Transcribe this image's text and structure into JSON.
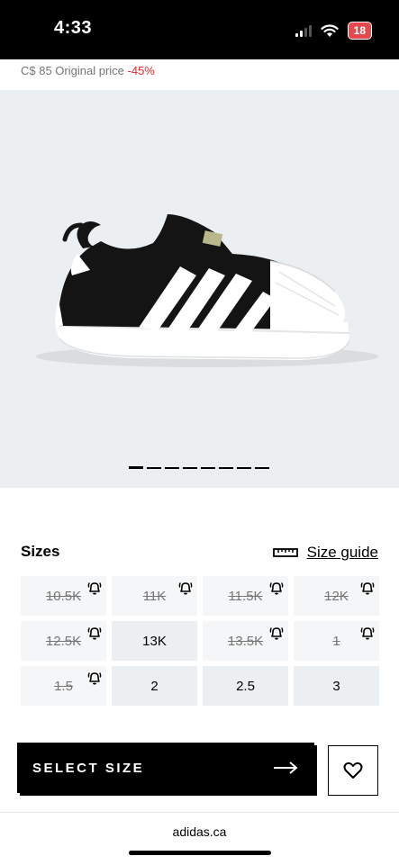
{
  "status_bar": {
    "time": "4:33",
    "battery": "18"
  },
  "price": {
    "original": "C$ 85 Original price",
    "discount": "-45%"
  },
  "carousel": {
    "count": 8,
    "active_index": 0
  },
  "sizes": {
    "title": "Sizes",
    "size_guide_label": "Size guide",
    "items": [
      {
        "label": "10.5K",
        "available": false
      },
      {
        "label": "11K",
        "available": false
      },
      {
        "label": "11.5K",
        "available": false
      },
      {
        "label": "12K",
        "available": false
      },
      {
        "label": "12.5K",
        "available": false
      },
      {
        "label": "13K",
        "available": true
      },
      {
        "label": "13.5K",
        "available": false
      },
      {
        "label": "1",
        "available": false
      },
      {
        "label": "1.5",
        "available": false
      },
      {
        "label": "2",
        "available": true
      },
      {
        "label": "2.5",
        "available": true
      },
      {
        "label": "3",
        "available": true
      }
    ]
  },
  "cta": {
    "label": "SELECT SIZE"
  },
  "browser": {
    "domain": "adidas.ca"
  },
  "icons": {
    "wishlist": "heart-icon",
    "notify": "bell-icon",
    "size_guide": "ruler-icon",
    "arrow": "arrow-right-icon"
  },
  "colors": {
    "discount": "#e32b2b",
    "primary": "#000000",
    "image_bg": "#eceff1"
  }
}
